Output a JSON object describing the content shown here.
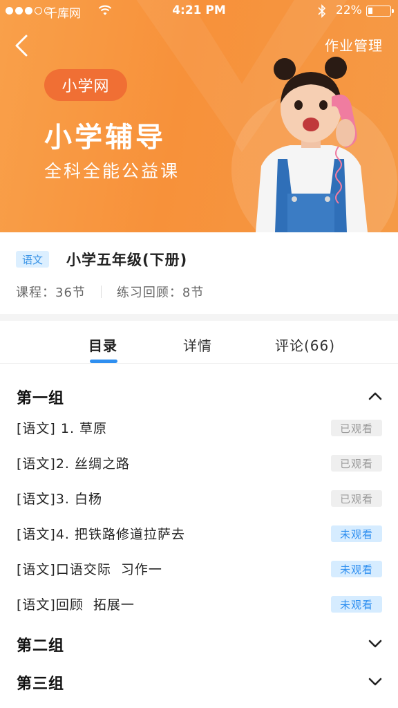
{
  "statusbar": {
    "carrier": "千库网",
    "time": "4:21 PM",
    "battery_pct": "22%",
    "battery_level": 0.22,
    "signal_full": 3,
    "signal_total": 5
  },
  "header": {
    "back_icon": "chevron-left-icon",
    "action_label": "作业管理"
  },
  "hero": {
    "brand": "小学网",
    "title": "小学辅导",
    "subtitle": "全科全能公益课"
  },
  "course": {
    "subject_tag": "语文",
    "title": "小学五年级(下册)",
    "lessons_label": "课程：36节",
    "review_label": "练习回顾：8节"
  },
  "tabs": [
    {
      "label": "目录",
      "active": true
    },
    {
      "label": "详情",
      "active": false
    },
    {
      "label": "评论(66)",
      "active": false
    }
  ],
  "groups": [
    {
      "title": "第一组",
      "expanded": true,
      "lessons": [
        {
          "title": "[语文] 1. 草原",
          "status": "已观看",
          "watched": true
        },
        {
          "title": "[语文]2. 丝绸之路",
          "status": "已观看",
          "watched": true
        },
        {
          "title": "[语文]3. 白杨",
          "status": "已观看",
          "watched": true
        },
        {
          "title": "[语文]4. 把铁路修道拉萨去",
          "status": "未观看",
          "watched": false
        },
        {
          "title": "[语文]口语交际  习作一",
          "status": "未观看",
          "watched": false
        },
        {
          "title": "[语文]回顾  拓展一",
          "status": "未观看",
          "watched": false
        }
      ]
    },
    {
      "title": "第二组",
      "expanded": false,
      "lessons": []
    },
    {
      "title": "第三组",
      "expanded": false,
      "lessons": []
    }
  ],
  "colors": {
    "accent": "#2f8ff0",
    "hero_orange": "#f7913a",
    "brand_pill": "#f06f34"
  }
}
